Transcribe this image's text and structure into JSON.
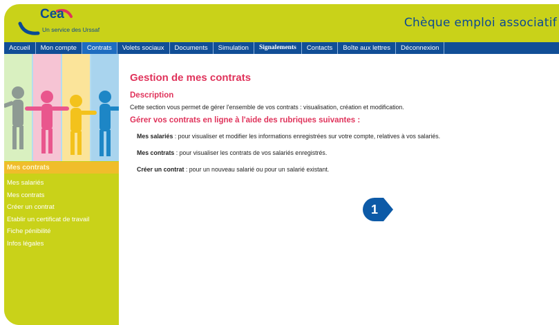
{
  "header": {
    "logo_text": "Cea",
    "logo_subtitle": "Un service des Urssaf",
    "app_title": "Chèque emploi associatif"
  },
  "nav": {
    "items": [
      {
        "label": "Accueil"
      },
      {
        "label": "Mon compte"
      },
      {
        "label": "Contrats"
      },
      {
        "label": "Volets sociaux"
      },
      {
        "label": "Documents"
      },
      {
        "label": "Simulation"
      },
      {
        "label": "Signalements"
      },
      {
        "label": "Contacts"
      },
      {
        "label": "Boîte aux lettres"
      },
      {
        "label": "Déconnexion"
      }
    ],
    "active": "Contrats"
  },
  "sidebar": {
    "heading": "Mes contrats",
    "items": [
      {
        "label": "Mes salariés"
      },
      {
        "label": "Mes contrats"
      },
      {
        "label": "Créer un contrat"
      },
      {
        "label": "Etablir un certificat de travail"
      },
      {
        "label": "Fiche pénibilité"
      },
      {
        "label": "Infos légales"
      }
    ]
  },
  "main": {
    "title": "Gestion de mes contrats",
    "description_heading": "Description",
    "description_text": "Cette section vous permet de gérer l'ensemble de vos contrats : visualisation, création et modification.",
    "rubriques_heading": "Gérer vos contrats en ligne à l'aide des rubriques suivantes :",
    "rubriques": [
      {
        "name": "Mes salariés",
        "text": " : pour visualiser et modifier les informations enregistrées sur votre compte, relatives à vos salariés."
      },
      {
        "name": "Mes contrats",
        "text": " : pour visualiser les contrats de vos salariés enregistrés."
      },
      {
        "name": "Créer un contrat",
        "text": " : pour un nouveau salarié ou pour un salarié existant."
      }
    ]
  },
  "marker": {
    "number": "1",
    "color": "#0d5aa7"
  },
  "colors": {
    "frame": "#c9d219",
    "nav": "#114e96",
    "nav_active": "#1e6cc0",
    "accent": "#e0335b",
    "sidebar_heading": "#f0bd2b"
  }
}
